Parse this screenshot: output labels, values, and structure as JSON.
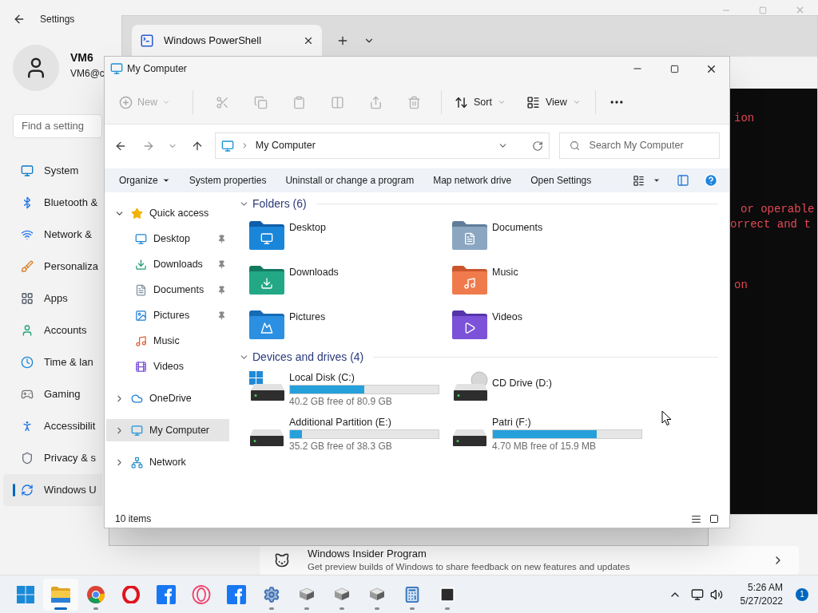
{
  "settings": {
    "title": "Settings",
    "user": {
      "name": "VM6",
      "email": "VM6@c"
    },
    "search": {
      "placeholder": "Find a setting"
    },
    "nav": [
      {
        "label": "System",
        "selected": false
      },
      {
        "label": "Bluetooth &",
        "selected": false
      },
      {
        "label": "Network &",
        "selected": false
      },
      {
        "label": "Personaliza",
        "selected": false
      },
      {
        "label": "Apps",
        "selected": false
      },
      {
        "label": "Accounts",
        "selected": false
      },
      {
        "label": "Time & lan",
        "selected": false
      },
      {
        "label": "Gaming",
        "selected": false
      },
      {
        "label": "Accessibilit",
        "selected": false
      },
      {
        "label": "Privacy & s",
        "selected": false
      },
      {
        "label": "Windows U",
        "selected": true
      }
    ],
    "insider": {
      "title": "Windows Insider Program",
      "description": "Get preview builds of Windows to share feedback on new features and updates"
    }
  },
  "terminal": {
    "tabs": [
      {
        "label": "Windows PowerShell",
        "selected": true
      }
    ],
    "lines": [
      "ion",
      "or operable",
      "orrect and t",
      "on"
    ]
  },
  "explorer": {
    "title": "My Computer",
    "toolbar": {
      "new": {
        "label": "New",
        "disabled": true
      },
      "actions": [
        {
          "disabled": true
        },
        {
          "disabled": true
        },
        {
          "disabled": true
        },
        {
          "disabled": true
        },
        {
          "disabled": true
        },
        {
          "disabled": true
        }
      ],
      "sort": "Sort",
      "view": "View"
    },
    "address": "My Computer",
    "search": {
      "placeholder": "Search My Computer"
    },
    "commands": [
      "Organize",
      "System properties",
      "Uninstall or change a program",
      "Map network drive",
      "Open Settings"
    ],
    "nav": [
      {
        "label": "Quick access",
        "expanded": true,
        "selected": false,
        "children": [
          {
            "label": "Desktop",
            "pinned": true
          },
          {
            "label": "Downloads",
            "pinned": true
          },
          {
            "label": "Documents",
            "pinned": true
          },
          {
            "label": "Pictures",
            "pinned": true
          },
          {
            "label": "Music",
            "pinned": false
          },
          {
            "label": "Videos",
            "pinned": false
          }
        ]
      },
      {
        "label": "OneDrive",
        "expanded": false,
        "selected": false
      },
      {
        "label": "My Computer",
        "expanded": false,
        "selected": true
      },
      {
        "label": "Network",
        "expanded": false,
        "selected": false
      }
    ],
    "folders": {
      "title": "Folders (6)",
      "expanded": true,
      "items": [
        "Desktop",
        "Documents",
        "Downloads",
        "Music",
        "Pictures",
        "Videos"
      ]
    },
    "drives": {
      "title": "Devices and drives (4)",
      "expanded": true,
      "items": [
        {
          "kind": "system",
          "name": "Local Disk (C:)",
          "level": 0.5,
          "free": "40.2 GB free of 80.9 GB"
        },
        {
          "kind": "optical",
          "name": "CD Drive (D:)"
        },
        {
          "kind": "disk",
          "name": "Additional Partition (E:)",
          "level": 0.08,
          "free": "35.2 GB free of 38.3 GB"
        },
        {
          "kind": "disk",
          "name": "Patri (F:)",
          "level": 0.7,
          "free": "4.70 MB free of 15.9 MB"
        }
      ]
    },
    "status": "10 items"
  },
  "taskbar": {
    "apps": [
      {
        "kind": "start",
        "running": false,
        "active": false
      },
      {
        "kind": "explorer",
        "running": true,
        "active": true
      },
      {
        "kind": "chrome",
        "running": true,
        "active": false
      },
      {
        "kind": "opera",
        "running": false,
        "active": false
      },
      {
        "kind": "facebook",
        "running": false,
        "active": false
      },
      {
        "kind": "operagx",
        "running": false,
        "active": false
      },
      {
        "kind": "facebook",
        "running": false,
        "active": false
      },
      {
        "kind": "settings",
        "running": true,
        "active": false
      },
      {
        "kind": "vm",
        "running": true,
        "active": false
      },
      {
        "kind": "vm",
        "running": true,
        "active": false
      },
      {
        "kind": "vm",
        "running": true,
        "active": false
      },
      {
        "kind": "calculator",
        "running": true,
        "active": false
      },
      {
        "kind": "terminal",
        "running": true,
        "active": false
      }
    ],
    "time": "5:26 AM",
    "date": "5/27/2022",
    "notifications": "1"
  }
}
